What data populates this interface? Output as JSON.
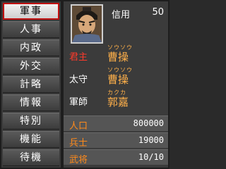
{
  "menu": {
    "items": [
      {
        "label": "軍事",
        "selected": true
      },
      {
        "label": "人事",
        "selected": false
      },
      {
        "label": "内政",
        "selected": false
      },
      {
        "label": "外交",
        "selected": false
      },
      {
        "label": "計略",
        "selected": false
      },
      {
        "label": "情報",
        "selected": false
      },
      {
        "label": "特別",
        "selected": false
      },
      {
        "label": "機能",
        "selected": false
      },
      {
        "label": "待機",
        "selected": false
      }
    ]
  },
  "info": {
    "credit_label": "信用",
    "credit_value": "50",
    "lord": {
      "label": "君主",
      "reading": "ソウソウ",
      "name": "曹操"
    },
    "governor": {
      "label": "太守",
      "reading": "ソウソウ",
      "name": "曹操"
    },
    "strategist": {
      "label": "軍師",
      "reading": "カクカ",
      "name": "郭嘉"
    },
    "stats": [
      {
        "label": "人口",
        "value": "800000"
      },
      {
        "label": "兵士",
        "value": "19000"
      },
      {
        "label": "武将",
        "value": "10/10"
      }
    ]
  },
  "colors": {
    "selected_border": "#c01010",
    "label_red": "#ff3a2a",
    "name_orange": "#ffb04a",
    "stat_orange": "#ff8a1a"
  },
  "icons": {
    "portrait": "general-portrait"
  }
}
